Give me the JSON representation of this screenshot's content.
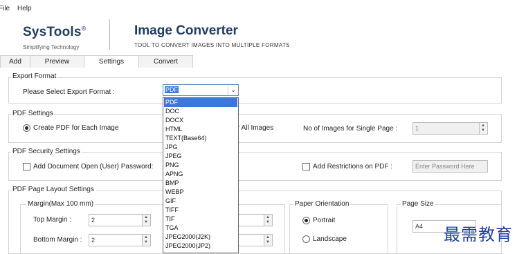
{
  "menu": {
    "file": "File",
    "help": "Help"
  },
  "header": {
    "brand": "SysTools",
    "brand_mark": "®",
    "tagline": "Simplifying Technology",
    "title_a": "Image",
    "title_b": "Converter",
    "subtitle": "TOOL TO CONVERT IMAGES INTO MULTIPLE FORMATS"
  },
  "tabs": [
    "Add",
    "Preview",
    "Settings",
    "Convert"
  ],
  "export": {
    "group": "Export Format",
    "label": "Please Select Export Format :",
    "selected": "PDF",
    "options": [
      "PDF",
      "DOC",
      "DOCX",
      "HTML",
      "TEXT(Base64)",
      "JPG",
      "JPEG",
      "PNG",
      "APNG",
      "BMP",
      "WEBP",
      "GIF",
      "TIFF",
      "TIF",
      "TGA",
      "JPEG2000(J2K)",
      "JPEG2000(JP2)"
    ]
  },
  "pdf": {
    "group": "PDF Settings",
    "create_each": "Create PDF for Each Image",
    "all_images": "r All Images",
    "no_images_label": "No of Images for Single Page :",
    "no_images_value": "1"
  },
  "security": {
    "group": "PDF Security Settings",
    "open_pw_label": "Add Document Open (User) Password:",
    "restrictions_label": "Add Restrictions on PDF :",
    "restrictions_placeholder": "Enter Password Here"
  },
  "layout": {
    "group": "PDF Page Layout Settings",
    "margin_group": "Margin(Max 100 mm)",
    "top_margin_label": "Top Margin :",
    "top_margin_value": "2",
    "bottom_margin_label": "Bottom Margin :",
    "bottom_margin_value": "2",
    "orientation_group": "Paper Orientation",
    "portrait": "Portrait",
    "landscape": "Landscape",
    "page_size_group": "Page Size",
    "page_size_value": "A4"
  },
  "watermark": "最需教育"
}
